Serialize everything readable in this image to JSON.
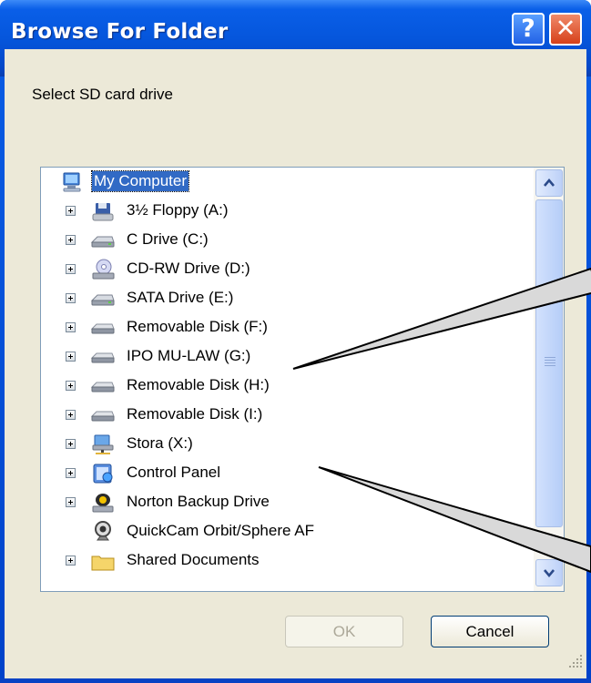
{
  "window": {
    "title": "Browse For Folder",
    "help_glyph": "?",
    "close_glyph": "✕"
  },
  "prompt": "Select SD card drive",
  "tree": {
    "root": {
      "label": "My Computer",
      "icon": "my-computer-icon"
    },
    "items": [
      {
        "label": "3½ Floppy (A:)",
        "icon": "floppy-drive-icon",
        "expandable": true
      },
      {
        "label": "C Drive (C:)",
        "icon": "hard-drive-icon",
        "expandable": true
      },
      {
        "label": "CD-RW Drive (D:)",
        "icon": "cd-drive-icon",
        "expandable": true
      },
      {
        "label": "SATA Drive (E:)",
        "icon": "hard-drive-icon",
        "expandable": true
      },
      {
        "label": "Removable Disk (F:)",
        "icon": "removable-disk-icon",
        "expandable": true
      },
      {
        "label": "IPO MU-LAW (G:)",
        "icon": "removable-disk-icon",
        "expandable": true
      },
      {
        "label": "Removable Disk (H:)",
        "icon": "removable-disk-icon",
        "expandable": true
      },
      {
        "label": "Removable Disk (I:)",
        "icon": "removable-disk-icon",
        "expandable": true
      },
      {
        "label": "Stora (X:)",
        "icon": "network-drive-icon",
        "expandable": true
      },
      {
        "label": "Control Panel",
        "icon": "control-panel-icon",
        "expandable": true
      },
      {
        "label": "Norton Backup Drive",
        "icon": "norton-drive-icon",
        "expandable": true
      },
      {
        "label": "QuickCam Orbit/Sphere AF",
        "icon": "webcam-icon",
        "expandable": false
      },
      {
        "label": "Shared Documents",
        "icon": "folder-icon",
        "expandable": true
      }
    ]
  },
  "buttons": {
    "ok": "OK",
    "cancel": "Cancel"
  },
  "colors": {
    "titlebar": "#0556dc",
    "selection": "#316ac5",
    "dialog_bg": "#ece9d8",
    "callout_fill": "#d9d9d9"
  }
}
